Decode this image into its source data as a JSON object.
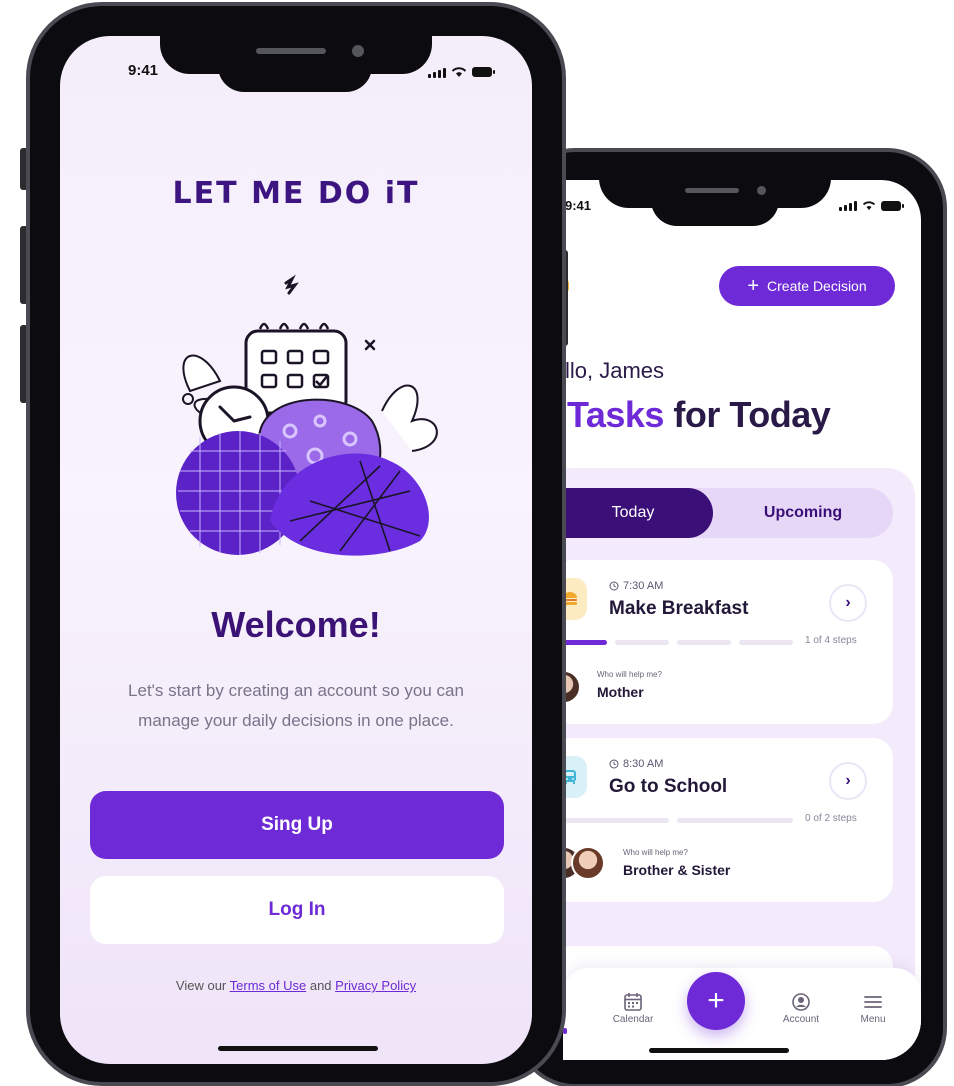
{
  "front": {
    "status_time": "9:41",
    "brand": "LET ME DO iT",
    "welcome": "Welcome!",
    "subtitle": "Let's start by creating an account so you can manage your daily decisions in one place.",
    "signup_label": "Sing Up",
    "login_label": "Log In",
    "legal_prefix": "View our",
    "terms_label": "Terms of Use",
    "legal_and": "and",
    "privacy_label": "Privacy Policy"
  },
  "back": {
    "status_time": "9:41",
    "create_label": "Create Decision",
    "greeting": "llo, James",
    "headline_accent": "Tasks",
    "headline_rest": "for Today",
    "tabs": {
      "today": "Today",
      "upcoming": "Upcoming"
    },
    "tasks": [
      {
        "time": "7:30 AM",
        "title": "Make Breakfast",
        "steps": "1 of 4 steps",
        "progress_done": 1,
        "progress_total": 4,
        "who_label": "Who will help me?",
        "helper": "Mother",
        "icon": "burger-icon"
      },
      {
        "time": "8:30 AM",
        "title": "Go to School",
        "steps": "0 of 2 steps",
        "progress_done": 0,
        "progress_total": 2,
        "who_label": "Who will help me?",
        "helper": "Brother & Sister",
        "icon": "bus-icon"
      }
    ],
    "nav": {
      "calendar": "Calendar",
      "account": "Account",
      "menu": "Menu"
    }
  },
  "colors": {
    "accent": "#6d2ad6",
    "deep": "#3a0f78",
    "heading": "#3b1275"
  }
}
